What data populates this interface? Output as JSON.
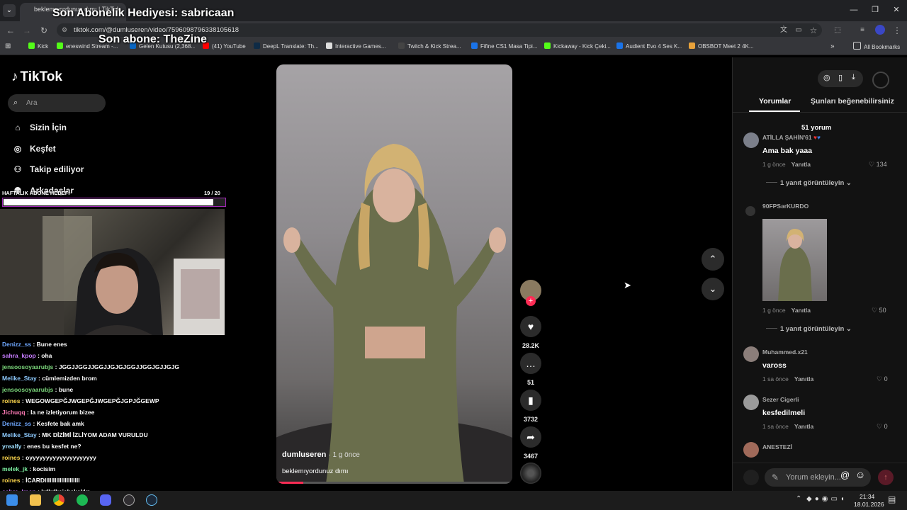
{
  "browser": {
    "tab_title": "beklemıyordunuz dımı | TikTok",
    "url": "tiktok.com/@dumluseren/video/7596098796338105618",
    "bookmarks": [
      "Kick",
      "eneswind Stream -...",
      "Gelen Kutusu (2,368...",
      "(41) YouTube",
      "DeepL Translate: Th...",
      "Interactive Games...",
      "Twitch & Kick Strea...",
      "Fifine CS1 Masa Tipi...",
      "Kickaway - Kick Çeki...",
      "Audient Evo 4 Ses K...",
      "OBSBOT Meet 2 4K..."
    ],
    "all_bookmarks": "All Bookmarks"
  },
  "overlay": {
    "last_gift": "Son Abonelik Hediyesi: sabricaan",
    "last_sub": "Son abone: TheZine",
    "goal_label": "HAFTALIK ABONE HEDEFİ",
    "goal_count": "19 / 20",
    "goal_progress": 0.95
  },
  "tiktok": {
    "logo": "TikTok",
    "search_placeholder": "Ara",
    "nav": [
      "Sizin İçin",
      "Keşfet",
      "Takip ediliyor",
      "Arkadaşlar"
    ]
  },
  "chat": [
    {
      "user": "Denizz_ss",
      "text": "Bune enes",
      "color": "#6fa8ff"
    },
    {
      "user": "sahra_kpop",
      "text": "oha",
      "color": "#c77dff"
    },
    {
      "user": "jensoosoyaarubjs",
      "text": "JGGJJGGJJGGJJGJGJGGJJGGJGJJGJG",
      "color": "#7bd67b"
    },
    {
      "user": "Melike_Stay",
      "text": "cümlemizden brom",
      "color": "#8ecbff"
    },
    {
      "user": "jensoosoyaarubjs",
      "text": "bune",
      "color": "#7bd67b"
    },
    {
      "user": "roines",
      "text": "WEGOWGEPĞJWGEPĞJWGEPĞJGPJĞGEWP",
      "color": "#ffd84d"
    },
    {
      "user": "Jichuqq",
      "text": "la ne izletiyorum bizee",
      "color": "#ff7ab6"
    },
    {
      "user": "Denizz_ss",
      "text": "Kesfete bak amk",
      "color": "#6fa8ff"
    },
    {
      "user": "Melike_Stay",
      "text": "MK DİZİMİ İZLİYOM ADAM VURULDU",
      "color": "#8ecbff"
    },
    {
      "user": "yrealfy",
      "text": "enes bu kesfet ne?",
      "color": "#9fe0ff"
    },
    {
      "user": "roines",
      "text": "oyyyyyyyyyyyyyyyyyyyy",
      "color": "#ffd84d"
    },
    {
      "user": "melek_jk",
      "text": "kocisim",
      "color": "#7cf0a0"
    },
    {
      "user": "roines",
      "text": "İCARDIIIIIIIIIIIIIIIIIIIII",
      "color": "#ffd84d"
    },
    {
      "user": "sahra_kpop",
      "text": "kdkdkejekekekkr",
      "color": "#c77dff"
    }
  ],
  "video": {
    "author": "dumluseren",
    "age": "· 1 g önce",
    "caption": "beklemıyordunuz dımı",
    "likes": "28.2K",
    "comments": "51",
    "saves": "3732",
    "shares": "3467"
  },
  "panel": {
    "tab_comments": "Yorumlar",
    "tab_suggested": "Şunları beğenebilirsiniz",
    "comment_count": "51 yorum",
    "reply_label": "Yanıtla",
    "comments": [
      {
        "name": "ATİLLA ŞAHİN'61",
        "text": "Ama bak yaaa",
        "time": "1 g önce",
        "likes": "134",
        "more": "1 yanıt görüntüleyin"
      },
      {
        "name": "90FPSərKURDO",
        "text": "",
        "time": "1 g önce",
        "likes": "50",
        "more": "1 yanıt görüntüleyin"
      },
      {
        "name": "Muhammed.x21",
        "text": "vaross",
        "time": "1 sa önce",
        "likes": "0"
      },
      {
        "name": "Sezer Cigerli",
        "text": "kesfedilmeli",
        "time": "1 sa önce",
        "likes": "0"
      },
      {
        "name": "ANESTEZİ",
        "text": "",
        "time": "",
        "likes": ""
      }
    ],
    "comment_placeholder": "Yorum ekleyin..."
  },
  "taskbar": {
    "time": "21:34",
    "date": "18.01.2026"
  }
}
